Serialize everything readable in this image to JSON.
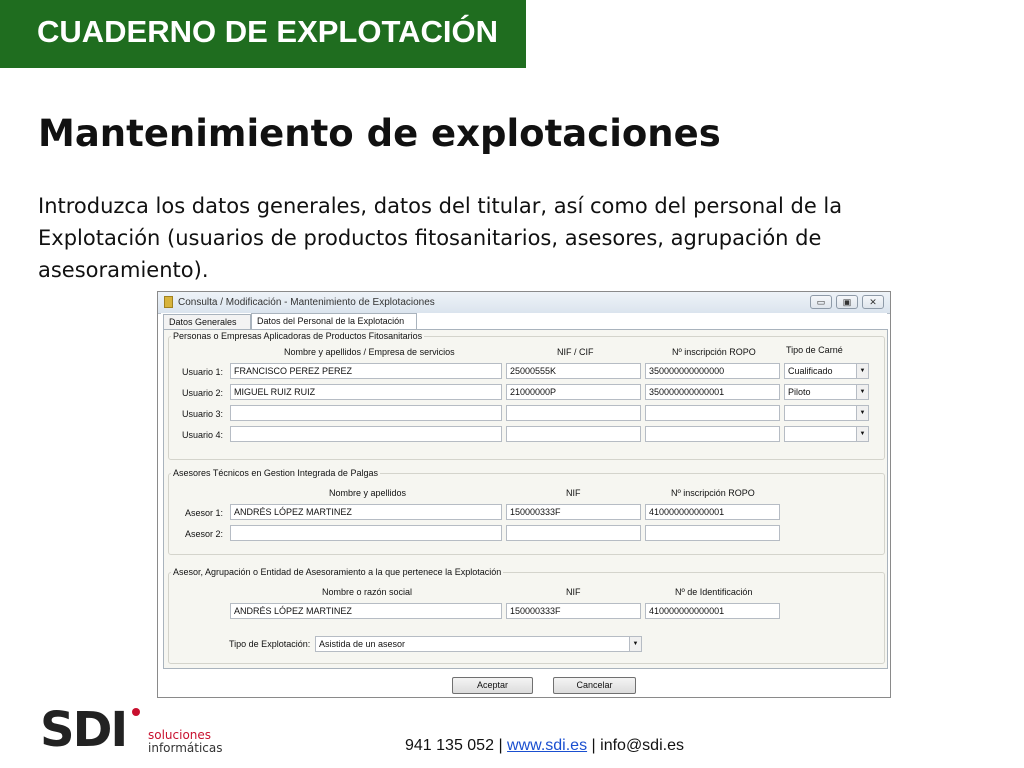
{
  "banner": {
    "title": "CUADERNO DE EXPLOTACIÓN"
  },
  "heading": "Mantenimiento de explotaciones",
  "intro": "Introduzca los datos generales, datos del titular, así como del personal de la Explotación (usuarios de productos fitosanitarios, asesores, agrupación de asesoramiento).",
  "window": {
    "title": "Consulta / Modificación - Mantenimiento de Explotaciones",
    "tabs": [
      "Datos Generales",
      "Datos del Personal de la Explotación"
    ],
    "applicators": {
      "legend": "Personas o Empresas Aplicadoras de Productos Fitosanitarios",
      "columns": [
        "Nombre y apellidos / Empresa de servicios",
        "NIF / CIF",
        "Nº inscripción ROPO",
        "Tipo de Carné"
      ],
      "rows": [
        {
          "label": "Usuario 1:",
          "name": "FRANCISCO PEREZ PEREZ",
          "nif": "25000555K",
          "ropo": "350000000000000",
          "carne": "Cualificado"
        },
        {
          "label": "Usuario 2:",
          "name": "MIGUEL RUIZ RUIZ",
          "nif": "21000000P",
          "ropo": "350000000000001",
          "carne": "Piloto"
        },
        {
          "label": "Usuario 3:",
          "name": "",
          "nif": "",
          "ropo": "",
          "carne": ""
        },
        {
          "label": "Usuario 4:",
          "name": "",
          "nif": "",
          "ropo": "",
          "carne": ""
        }
      ]
    },
    "advisors": {
      "legend": "Asesores Técnicos en Gestion Integrada de Palgas",
      "columns": [
        "Nombre y apellidos",
        "NIF",
        "Nº inscripción ROPO"
      ],
      "rows": [
        {
          "label": "Asesor 1:",
          "name": "ANDRÉS LÓPEZ MARTINEZ",
          "nif": "150000333F",
          "ropo": "410000000000001"
        },
        {
          "label": "Asesor 2:",
          "name": "",
          "nif": "",
          "ropo": ""
        }
      ]
    },
    "group": {
      "legend": "Asesor, Agrupación o Entidad de Asesoramiento a la que pertenece la Explotación",
      "columns": [
        "Nombre o razón social",
        "NIF",
        "Nº de Identificación"
      ],
      "name": "ANDRÉS LÓPEZ MARTINEZ",
      "nif": "150000333F",
      "id": "410000000000001",
      "tipo_label": "Tipo de Explotación:",
      "tipo_value": "Asistida de un asesor"
    },
    "buttons": {
      "accept": "Aceptar",
      "cancel": "Cancelar"
    }
  },
  "footer": {
    "logo": "SDI",
    "logo_sub1": "soluciones",
    "logo_sub2": "informáticas",
    "phone": "941 135 052",
    "sep1": "|",
    "web": "www.sdi.es",
    "sep2": "|",
    "email": "info@sdi.es"
  }
}
